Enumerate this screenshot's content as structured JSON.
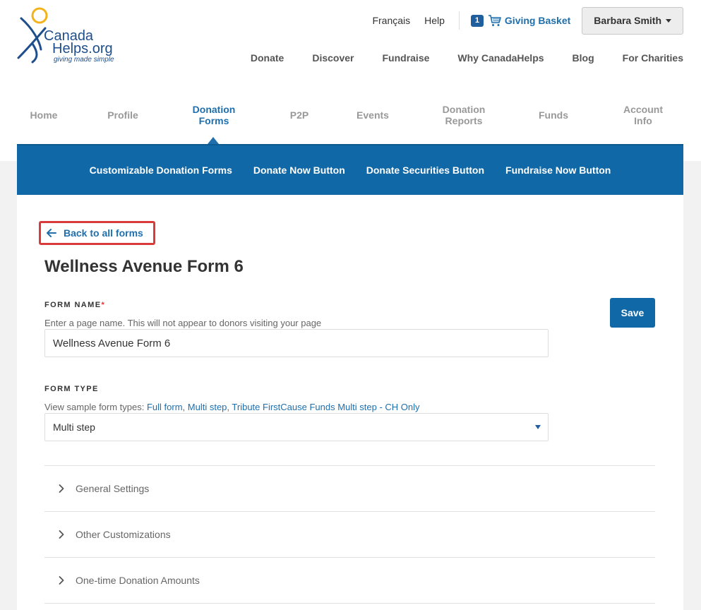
{
  "header": {
    "logo_name_1": "Canada",
    "logo_name_2": "Helps.org",
    "logo_tag": "giving made simple",
    "lang_link": "Français",
    "help_link": "Help",
    "basket_count": "1",
    "basket_label": "Giving Basket",
    "user_name": "Barbara Smith",
    "main_nav": [
      "Donate",
      "Discover",
      "Fundraise",
      "Why CanadaHelps",
      "Blog",
      "For Charities"
    ]
  },
  "tabs": [
    {
      "line1": "Home",
      "line2": ""
    },
    {
      "line1": "Profile",
      "line2": ""
    },
    {
      "line1": "Donation",
      "line2": "Forms"
    },
    {
      "line1": "P2P",
      "line2": ""
    },
    {
      "line1": "Events",
      "line2": ""
    },
    {
      "line1": "Donation",
      "line2": "Reports"
    },
    {
      "line1": "Funds",
      "line2": ""
    },
    {
      "line1": "Account",
      "line2": "Info"
    }
  ],
  "subnav": [
    "Customizable Donation Forms",
    "Donate Now Button",
    "Donate Securities Button",
    "Fundraise Now Button"
  ],
  "form": {
    "back_label": "Back to all forms",
    "title": "Wellness Avenue Form 6",
    "save_label": "Save",
    "name_label": "FORM NAME",
    "name_required": "*",
    "name_help": "Enter a page name. This will not appear to donors visiting your page",
    "name_value": "Wellness Avenue Form 6",
    "type_label": "FORM TYPE",
    "type_help_prefix": "View sample form types: ",
    "type_links": [
      "Full form",
      "Multi step",
      "Tribute FirstCause Funds Multi step - CH Only"
    ],
    "type_value": "Multi step"
  },
  "accordion": [
    "General Settings",
    "Other Customizations",
    "One-time Donation Amounts"
  ],
  "colors": {
    "brand_blue": "#1068a6",
    "link_blue": "#1f6fad",
    "highlight_red": "#d93a3a"
  }
}
